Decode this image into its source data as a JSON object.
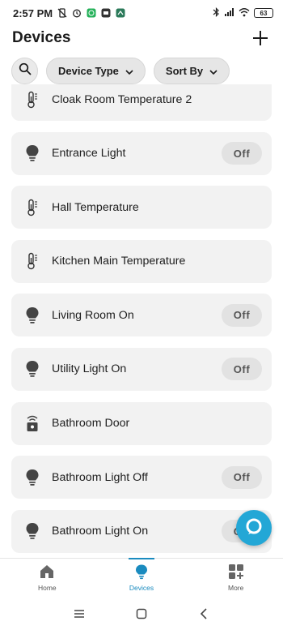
{
  "status_bar": {
    "time": "2:57 PM",
    "battery": "63",
    "icons": [
      "vibrate-off-icon",
      "alarm-icon",
      "whatsapp-icon",
      "app-icon",
      "app-icon-2",
      "bluetooth-icon",
      "mobile-data-icon",
      "wifi-icon",
      "battery-icon"
    ]
  },
  "header": {
    "title": "Devices",
    "add_icon": "plus-icon"
  },
  "filters": {
    "search_icon": "search-icon",
    "device_type_label": "Device Type",
    "sort_by_label": "Sort By"
  },
  "devices": [
    {
      "name": "Cloak Room Temperature 2",
      "icon": "thermometer-icon",
      "toggle": ""
    },
    {
      "name": "Entrance Light",
      "icon": "bulb-icon",
      "toggle": "Off"
    },
    {
      "name": "Hall Temperature",
      "icon": "thermometer-icon",
      "toggle": ""
    },
    {
      "name": "Kitchen Main Temperature",
      "icon": "thermometer-icon",
      "toggle": ""
    },
    {
      "name": "Living Room On",
      "icon": "bulb-icon",
      "toggle": "Off"
    },
    {
      "name": "Utility Light On",
      "icon": "bulb-icon",
      "toggle": "Off"
    },
    {
      "name": "Bathroom Door",
      "icon": "door-sensor-icon",
      "toggle": ""
    },
    {
      "name": "Bathroom Light Off",
      "icon": "bulb-icon",
      "toggle": "Off"
    },
    {
      "name": "Bathroom Light On",
      "icon": "bulb-icon",
      "toggle": "Off"
    }
  ],
  "bottom_nav": {
    "items": [
      {
        "label": "Home",
        "icon": "home-icon"
      },
      {
        "label": "Devices",
        "icon": "devices-bulb-icon",
        "active": true
      },
      {
        "label": "More",
        "icon": "grid-plus-icon"
      }
    ]
  },
  "alexa_button": {
    "icon": "alexa-ring-icon"
  },
  "colors": {
    "accent": "#1a8bbf",
    "alexa": "#23a7d6",
    "card_bg": "#f2f2f2",
    "chip_bg": "#e6e6e6"
  }
}
